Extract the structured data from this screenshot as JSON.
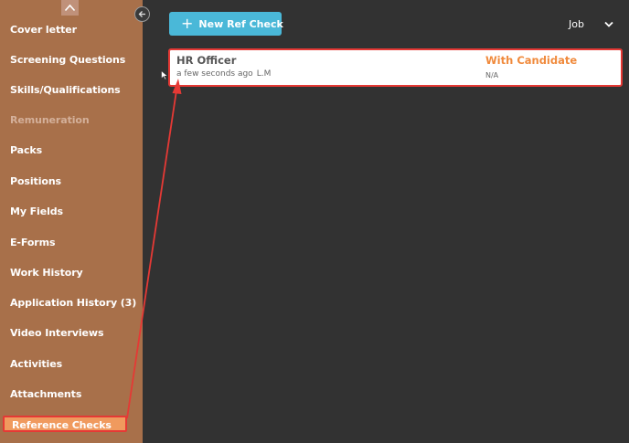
{
  "sidebar": {
    "items": [
      {
        "label": "Cover letter",
        "state": "normal"
      },
      {
        "label": "Screening Questions",
        "state": "normal"
      },
      {
        "label": "Skills/Qualifications",
        "state": "normal"
      },
      {
        "label": "Remuneration",
        "state": "disabled"
      },
      {
        "label": "Packs",
        "state": "normal"
      },
      {
        "label": "Positions",
        "state": "normal"
      },
      {
        "label": "My Fields",
        "state": "normal"
      },
      {
        "label": "E-Forms",
        "state": "normal"
      },
      {
        "label": "Work History",
        "state": "normal"
      },
      {
        "label": "Application History (3)",
        "state": "normal"
      },
      {
        "label": "Video Interviews",
        "state": "normal"
      },
      {
        "label": "Activities",
        "state": "normal"
      },
      {
        "label": "Attachments",
        "state": "normal"
      },
      {
        "label": "Reference Checks",
        "state": "active"
      }
    ]
  },
  "toolbar": {
    "new_ref_label": "New Ref Check",
    "filter_value": "Job"
  },
  "ref_checks": [
    {
      "title": "HR Officer",
      "time": "a few seconds ago",
      "initials": "L.M",
      "status": "With Candidate",
      "sub_status": "N/A"
    }
  ],
  "colors": {
    "sidebar_bg": "#a8704a",
    "active_item_bg": "#f09a5e",
    "annotation_red": "#e53935",
    "button_blue": "#4ab8d8",
    "status_orange": "#f08a3c",
    "main_bg": "#323232"
  },
  "icons": [
    "chevron-up-icon",
    "arrow-left-icon",
    "plus-icon",
    "chevron-down-icon",
    "cursor-icon"
  ]
}
